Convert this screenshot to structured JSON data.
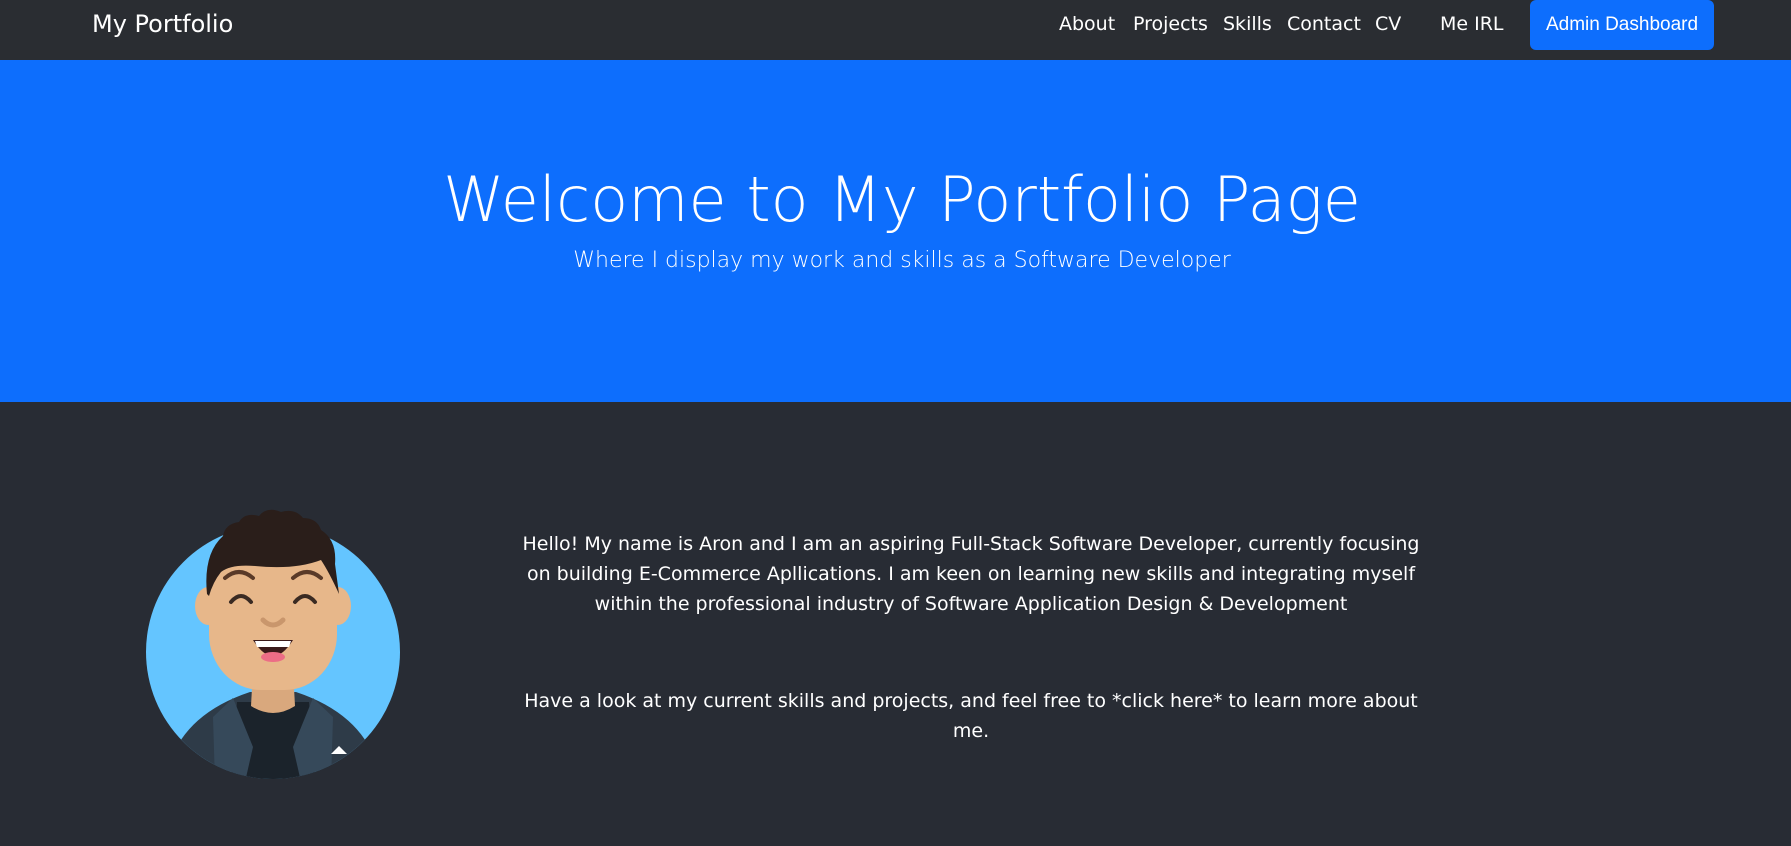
{
  "navbar": {
    "brand": "My Portfolio",
    "links": [
      {
        "label": "About"
      },
      {
        "label": "Projects"
      },
      {
        "label": "Skills"
      },
      {
        "label": "Contact"
      },
      {
        "label": "CV"
      },
      {
        "label": "Me IRL"
      }
    ],
    "admin_button": "Admin Dashboard"
  },
  "hero": {
    "title": "Welcome to My Portfolio Page",
    "subtitle": "Where I display my work and skills as a Software Developer"
  },
  "about": {
    "intro": "Hello! My name is Aron and I am an aspiring Full-Stack Software Developer, currently focusing on building E-Commerce Apllications. I am keen on learning new skills and integrating myself within the professional industry of Software Application Design & Development",
    "cta": "Have a look at my current skills and projects, and feel free to *click here* to learn more about me."
  },
  "colors": {
    "navbar_bg": "#2a2d32",
    "accent": "#0d6efd",
    "page_bg": "#282c34",
    "avatar_bg": "#64c5ff"
  }
}
